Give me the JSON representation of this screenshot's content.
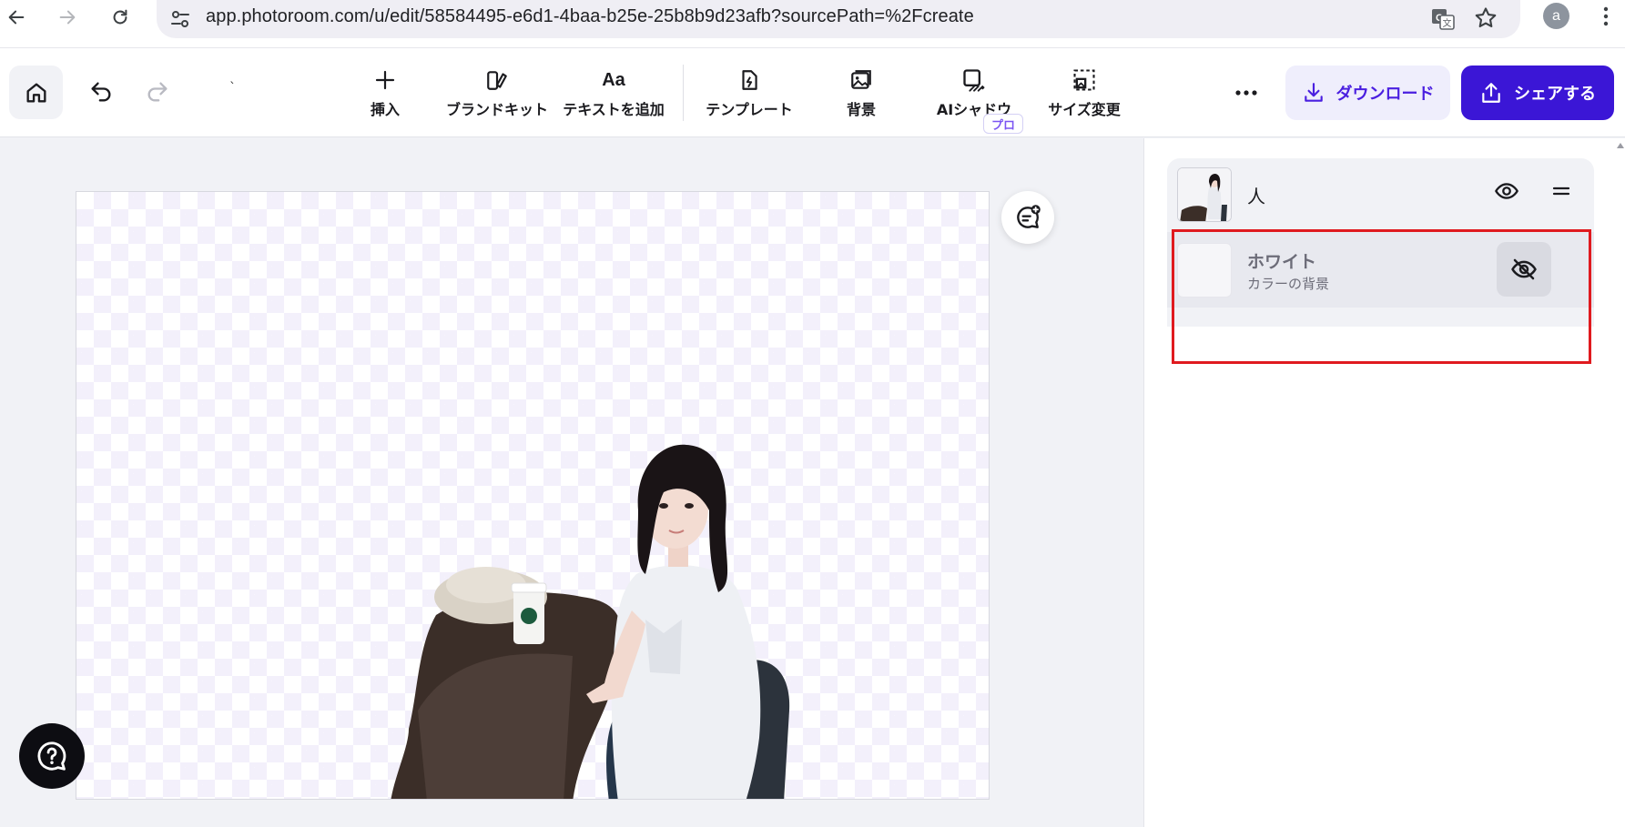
{
  "browser": {
    "url": "app.photoroom.com/u/edit/58584495-e6d1-4baa-b25e-25b8b9d23afb?sourcePath=%2Fcreate",
    "avatar_initial": "a",
    "icons": [
      "back-arrow-icon",
      "forward-arrow-icon",
      "reload-icon",
      "site-settings-icon",
      "translate-icon",
      "star-icon",
      "kebab-menu-icon"
    ]
  },
  "toolbar": {
    "tick": "`",
    "tools": {
      "insert": "挿入",
      "brand_kit": "ブランドキット",
      "add_text": "テキストを追加",
      "add_text_glyph": "Aa",
      "template": "テンプレート",
      "background": "背景",
      "ai_shadow": "AIシャドウ",
      "ai_shadow_badge": "プロ",
      "resize": "サイズ変更"
    },
    "download_label": "ダウンロード",
    "share_label": "シェアする"
  },
  "panel": {
    "layers": [
      {
        "name": "人",
        "visible": true
      },
      {
        "name": "ホワイト",
        "subtitle": "カラーの背景",
        "visible": false
      }
    ]
  },
  "colors": {
    "accent": "#3b16d6",
    "accent_soft": "#efeefc",
    "highlight": "#e01a1f",
    "pro_badge": "#7b55f2"
  }
}
